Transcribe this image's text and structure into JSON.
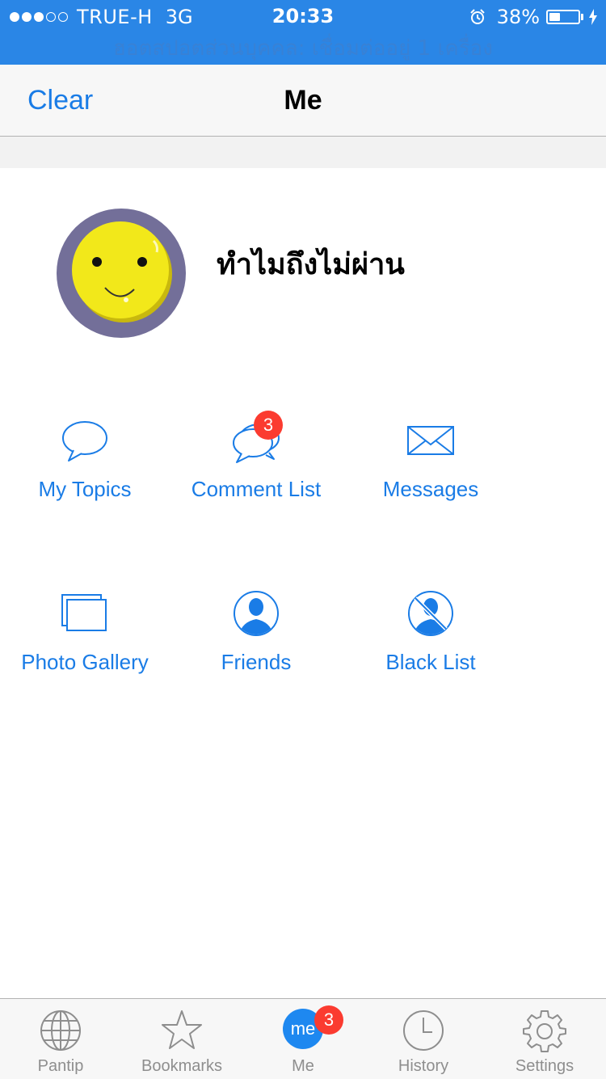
{
  "status_bar": {
    "carrier": "TRUE-H",
    "network": "3G",
    "time": "20:33",
    "battery_percent_text": "38%",
    "battery_level": 0.38,
    "signal_bars": 3,
    "signal_total": 5,
    "hotspot_text": "ฮอตสปอตส่วนบุคคล: เชื่อมต่ออยู่ 1 เครื่อง",
    "background_color": "#2a86e6"
  },
  "nav": {
    "clear_label": "Clear",
    "title": "Me"
  },
  "profile": {
    "username": "ทำไมถึงไม่ผ่าน",
    "avatar_icon": "smiley-face-avatar"
  },
  "menu": {
    "my_topics": {
      "label": "My Topics",
      "icon": "speech-bubble-icon"
    },
    "comment_list": {
      "label": "Comment List",
      "icon": "speech-bubbles-icon",
      "badge": "3"
    },
    "messages": {
      "label": "Messages",
      "icon": "envelope-icon"
    },
    "photo_gallery": {
      "label": "Photo Gallery",
      "icon": "gallery-icon"
    },
    "friends": {
      "label": "Friends",
      "icon": "person-icon"
    },
    "black_list": {
      "label": "Black List",
      "icon": "blocked-person-icon"
    }
  },
  "tabs": {
    "pantip": {
      "label": "Pantip",
      "icon": "globe-icon"
    },
    "bookmarks": {
      "label": "Bookmarks",
      "icon": "star-icon"
    },
    "me": {
      "label": "Me",
      "icon_text": "me",
      "badge": "3",
      "active": true
    },
    "history": {
      "label": "History",
      "icon": "clock-icon"
    },
    "settings": {
      "label": "Settings",
      "icon": "gear-icon"
    }
  },
  "colors": {
    "accent": "#1a7ce6",
    "badge": "#fb3b30",
    "tab_inactive": "#8e8e8e",
    "avatar_ring": "#736f99",
    "avatar_face": "#f2e81a"
  }
}
